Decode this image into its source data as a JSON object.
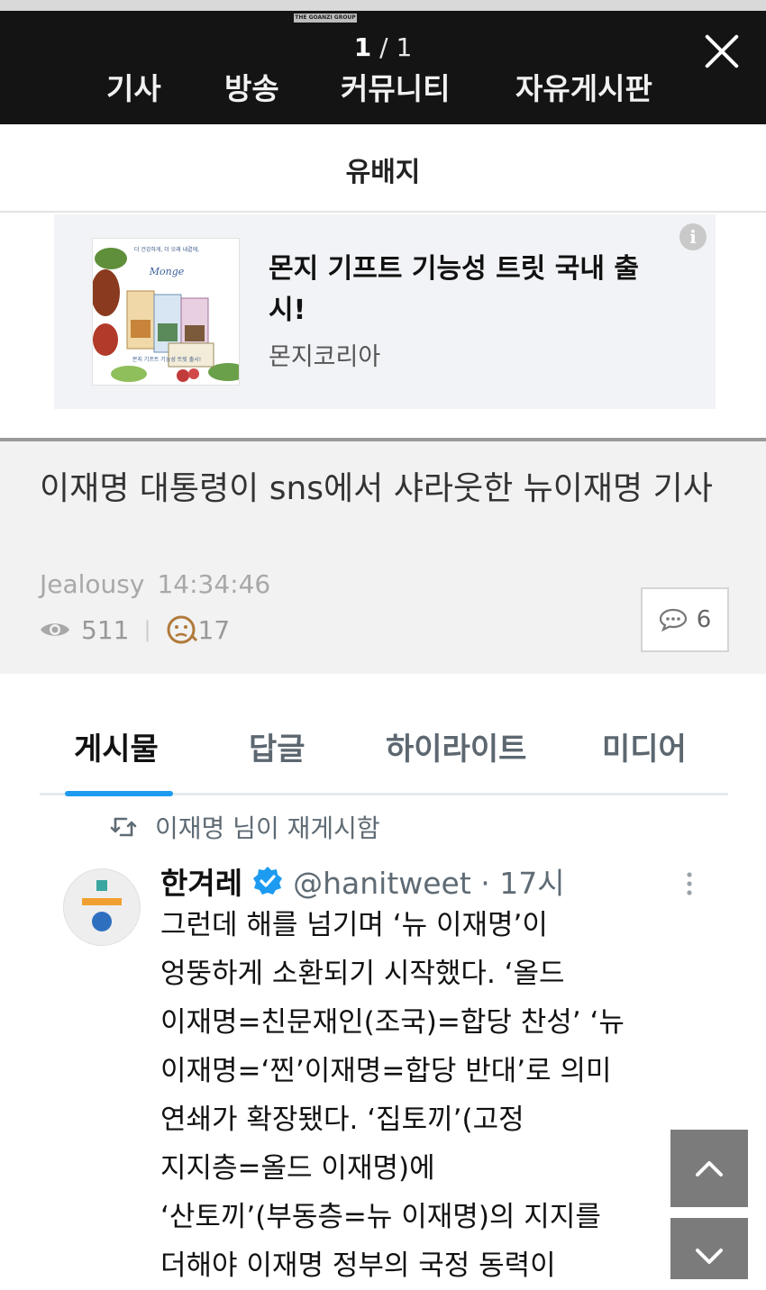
{
  "viewer": {
    "brand": "THE GOANZI GROUP",
    "page_current": "1",
    "page_rest": "/ 1",
    "nav": [
      "기사",
      "방송",
      "커뮤니티",
      "자유게시판"
    ],
    "close_icon": "close-icon"
  },
  "site": {
    "title": "유배지"
  },
  "ad": {
    "title": "몬지 기프트 기능성 트릿 국내 출시!",
    "advertiser": "몬지코리아",
    "info_icon": "i",
    "image": {
      "top_text": "더 건강하게, 더 오래 내곁에,",
      "logo": "Monge",
      "bottom_text": "몬지 기프트 기능성 트릿 출시!"
    }
  },
  "post": {
    "title": "이재명 대통령이 sns에서 샤라웃한 뉴이재명 기사",
    "author": "Jealousy",
    "time": "14:34:46",
    "views": "511",
    "reactions": "17",
    "comments": "6"
  },
  "tweet": {
    "tabs": [
      "게시물",
      "답글",
      "하이라이트",
      "미디어"
    ],
    "active_tab": 0,
    "retweet_text": "이재명 님이 재게시함",
    "name": "한겨레",
    "handle": "@hanitweet · 17시",
    "body_lines": [
      "그런데 해를 넘기며 ‘뉴 이재명’이",
      "엉뚱하게 소환되기 시작했다. ‘올드",
      "이재명=친문재인(조국)=합당 찬성’ ‘뉴",
      "이재명=‘찐’이재명=합당 반대’로 의미",
      "연쇄가 확장됐다. ‘집토끼’(고정",
      "지지층=올드 이재명)에",
      "‘산토끼’(부동층=뉴 이재명)의 지지를",
      "더해야 이재명 정부의 국정 동력이"
    ]
  },
  "colors": {
    "accent": "#1d9bf0",
    "verified": "#1d9bf0",
    "topbar": "#141414"
  }
}
